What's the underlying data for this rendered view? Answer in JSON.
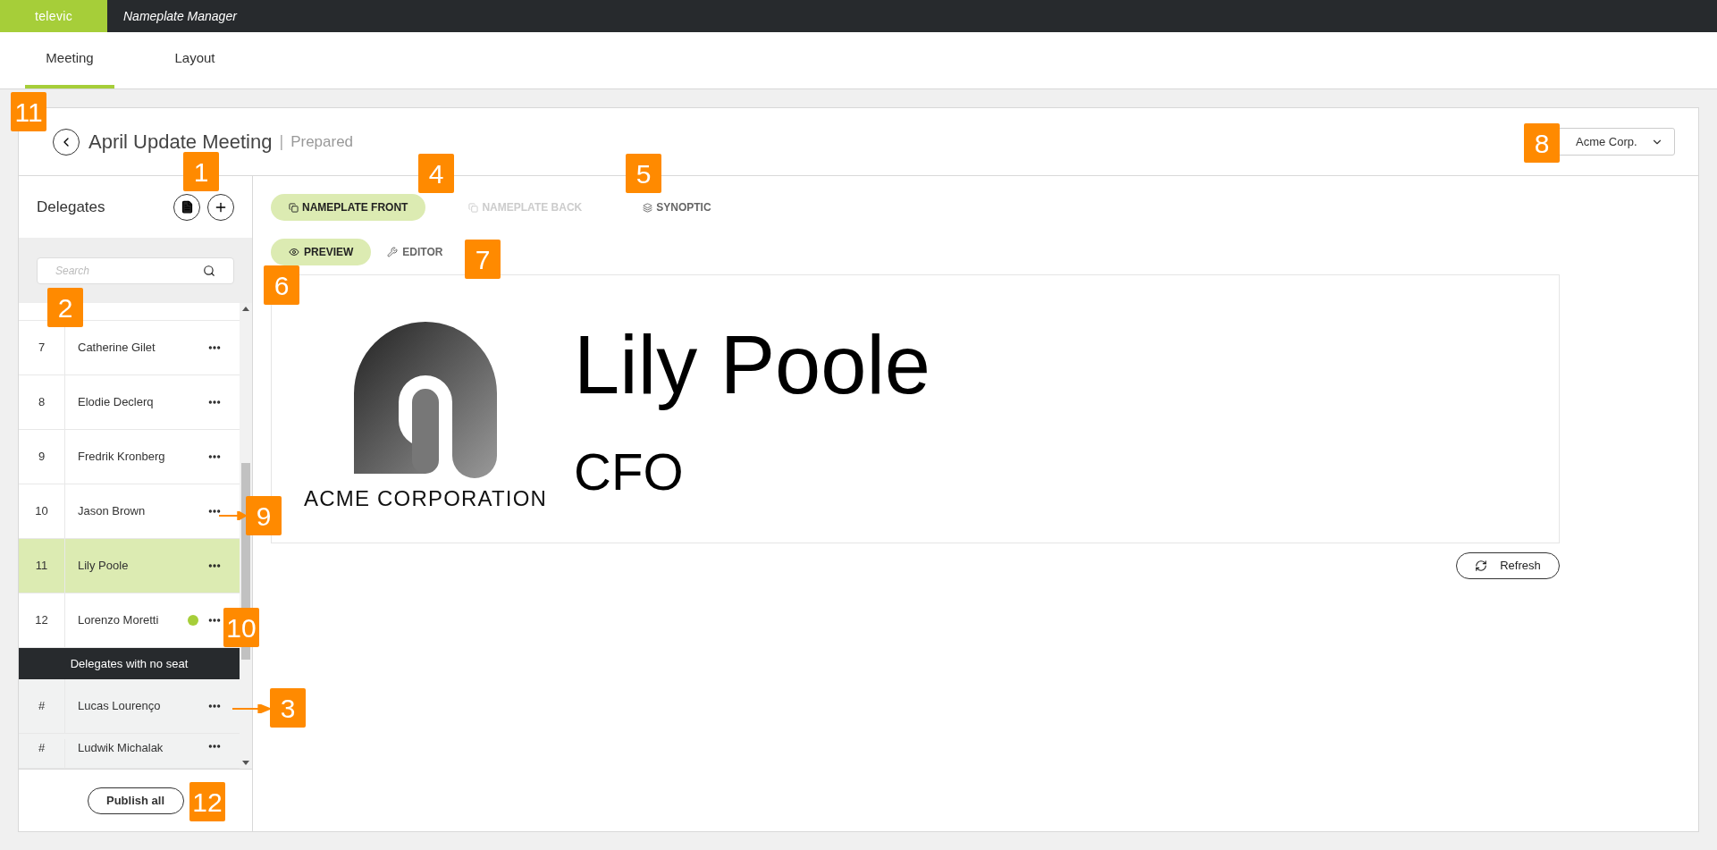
{
  "app_bar": {
    "logo": "televic",
    "title": "Nameplate Manager"
  },
  "tabs": [
    {
      "label": "Meeting",
      "selected": true
    },
    {
      "label": "Layout",
      "selected": false
    }
  ],
  "meeting": {
    "title": "April Update Meeting",
    "separator": "|",
    "status": "Prepared",
    "organization": "Acme Corp."
  },
  "delegates": {
    "title": "Delegates",
    "search": {
      "placeholder": "Search"
    },
    "seated": [
      {
        "seat": "7",
        "name": "Catherine Gilet",
        "selected": false
      },
      {
        "seat": "8",
        "name": "Elodie Declerq",
        "selected": false
      },
      {
        "seat": "9",
        "name": "Fredrik Kronberg",
        "selected": false
      },
      {
        "seat": "10",
        "name": "Jason Brown",
        "selected": false
      },
      {
        "seat": "11",
        "name": "Lily Poole",
        "selected": true
      },
      {
        "seat": "12",
        "name": "Lorenzo Moretti",
        "selected": false,
        "color": "#a6ce39"
      }
    ],
    "no_seat_header": "Delegates with no seat",
    "unseated": [
      {
        "seat": "#",
        "name": "Lucas Lourenço",
        "selected": false
      },
      {
        "seat": "#",
        "name": "Ludwik Michalak",
        "selected": false
      }
    ],
    "publish_button": "Publish all"
  },
  "view_tabs": [
    {
      "label": "NAMEPLATE FRONT",
      "selected": true,
      "disabled": false
    },
    {
      "label": "NAMEPLATE BACK",
      "selected": false,
      "disabled": true
    },
    {
      "label": "SYNOPTIC",
      "selected": false,
      "disabled": false
    }
  ],
  "mode_tabs": [
    {
      "label": "PREVIEW",
      "selected": true
    },
    {
      "label": "EDITOR",
      "selected": false
    }
  ],
  "nameplate": {
    "logo_text": "ACME CORPORATION",
    "name": "Lily Poole",
    "function": "CFO"
  },
  "refresh_button": "Refresh",
  "callouts": [
    "11",
    "1",
    "4",
    "5",
    "8",
    "7",
    "6",
    "2",
    "9",
    "10",
    "3",
    "12"
  ]
}
